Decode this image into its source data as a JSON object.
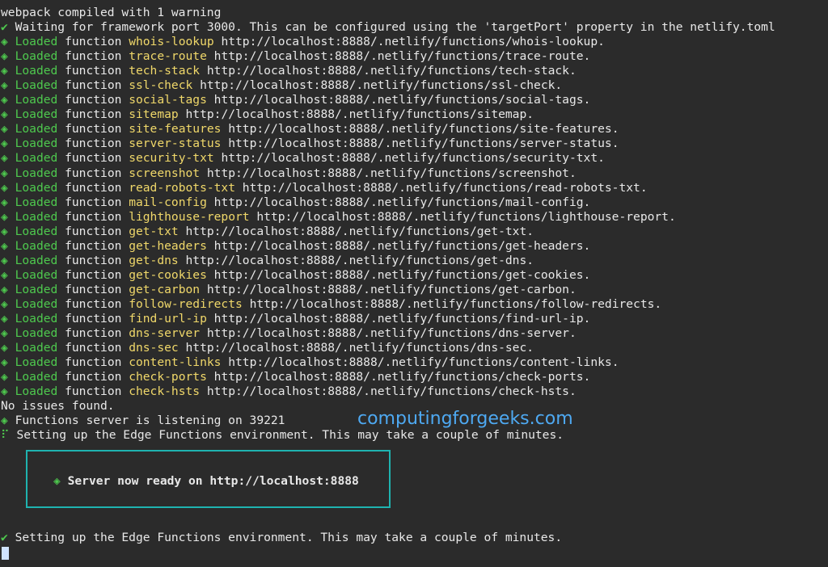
{
  "header": {
    "compiled": "webpack compiled with 1 warning",
    "check": "✔",
    "waiting": "Waiting for framework port 3000. This can be configured using the 'targetPort' property in the netlify.toml"
  },
  "loaded_word": "Loaded",
  "function_word": "function",
  "bullet": "◈",
  "functions": [
    {
      "name": "whois-lookup",
      "url": "http://localhost:8888/.netlify/functions/whois-lookup."
    },
    {
      "name": "trace-route",
      "url": "http://localhost:8888/.netlify/functions/trace-route."
    },
    {
      "name": "tech-stack",
      "url": "http://localhost:8888/.netlify/functions/tech-stack."
    },
    {
      "name": "ssl-check",
      "url": "http://localhost:8888/.netlify/functions/ssl-check."
    },
    {
      "name": "social-tags",
      "url": "http://localhost:8888/.netlify/functions/social-tags."
    },
    {
      "name": "sitemap",
      "url": "http://localhost:8888/.netlify/functions/sitemap."
    },
    {
      "name": "site-features",
      "url": "http://localhost:8888/.netlify/functions/site-features."
    },
    {
      "name": "server-status",
      "url": "http://localhost:8888/.netlify/functions/server-status."
    },
    {
      "name": "security-txt",
      "url": "http://localhost:8888/.netlify/functions/security-txt."
    },
    {
      "name": "screenshot",
      "url": "http://localhost:8888/.netlify/functions/screenshot."
    },
    {
      "name": "read-robots-txt",
      "url": "http://localhost:8888/.netlify/functions/read-robots-txt."
    },
    {
      "name": "mail-config",
      "url": "http://localhost:8888/.netlify/functions/mail-config."
    },
    {
      "name": "lighthouse-report",
      "url": "http://localhost:8888/.netlify/functions/lighthouse-report."
    },
    {
      "name": "get-txt",
      "url": "http://localhost:8888/.netlify/functions/get-txt."
    },
    {
      "name": "get-headers",
      "url": "http://localhost:8888/.netlify/functions/get-headers."
    },
    {
      "name": "get-dns",
      "url": "http://localhost:8888/.netlify/functions/get-dns."
    },
    {
      "name": "get-cookies",
      "url": "http://localhost:8888/.netlify/functions/get-cookies."
    },
    {
      "name": "get-carbon",
      "url": "http://localhost:8888/.netlify/functions/get-carbon."
    },
    {
      "name": "follow-redirects",
      "url": "http://localhost:8888/.netlify/functions/follow-redirects."
    },
    {
      "name": "find-url-ip",
      "url": "http://localhost:8888/.netlify/functions/find-url-ip."
    },
    {
      "name": "dns-server",
      "url": "http://localhost:8888/.netlify/functions/dns-server."
    },
    {
      "name": "dns-sec",
      "url": "http://localhost:8888/.netlify/functions/dns-sec."
    },
    {
      "name": "content-links",
      "url": "http://localhost:8888/.netlify/functions/content-links."
    },
    {
      "name": "check-ports",
      "url": "http://localhost:8888/.netlify/functions/check-ports."
    },
    {
      "name": "check-hsts",
      "url": "http://localhost:8888/.netlify/functions/check-hsts."
    }
  ],
  "footer": {
    "no_issues": "No issues found.",
    "listening": "Functions server is listening on 39221",
    "spinner": "⠏",
    "edge_setup": "Setting up the Edge Functions environment. This may take a couple of minutes.",
    "ready": "Server now ready on http://localhost:8888",
    "edge_done": "Setting up the Edge Functions environment. This may take a couple of minutes."
  },
  "watermark": "computingforgeeks.com",
  "colors": {
    "background": "#2b2b2b",
    "loaded_green": "#4ec94e",
    "function_name_yellow": "#f0d86a",
    "box_border": "#1fb3b0",
    "watermark_blue": "#4ea9f2"
  }
}
